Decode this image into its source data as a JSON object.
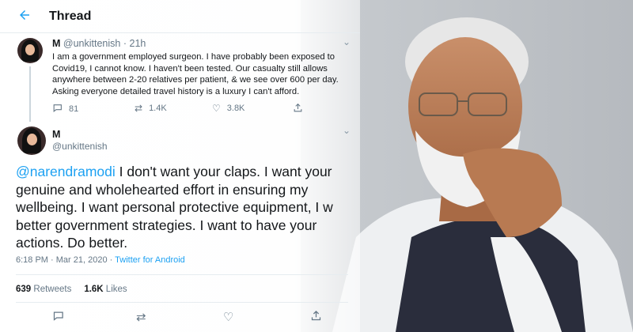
{
  "header": {
    "title": "Thread",
    "back_icon": "arrow-left-icon"
  },
  "tweet1": {
    "name": "M",
    "handle": "@unkittenish",
    "time": "21h",
    "text": "I am a government employed surgeon. I have probably been exposed to Covid19, I cannot know. I haven't been tested. Our casualty still allows anywhere between 2-20 relatives per patient, & we see over 600 per day. Asking everyone detailed travel history is a luxury I can't afford.",
    "replies": "81",
    "retweets": "1.4K",
    "likes": "3.8K"
  },
  "tweet2": {
    "name": "M",
    "handle": "@unkittenish",
    "mention": "@narendramodi",
    "text_after_mention": " I don't want your claps. I want your genuine and wholehearted effort in ensuring my wellbeing. I want personal protective equipment, I w better government strategies. I want to have your actions. Do better.",
    "timestamp": "6:18 PM · Mar 21, 2020 · ",
    "source": "Twitter for Android",
    "retweet_count": "639",
    "retweet_label": " Retweets",
    "like_count": "1.6K",
    "like_label": " Likes"
  },
  "colors": {
    "accent": "#1da1f2",
    "muted": "#657786",
    "text": "#14171a"
  }
}
